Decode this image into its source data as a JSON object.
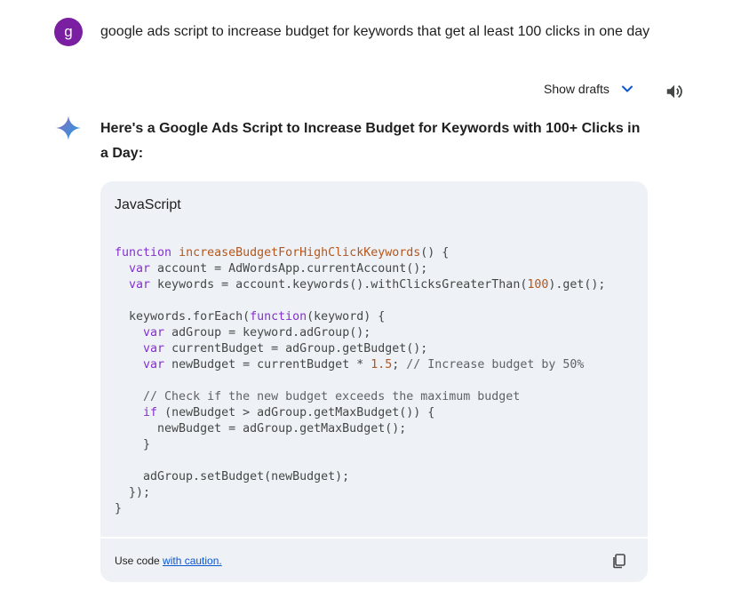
{
  "user": {
    "avatar_letter": "g",
    "avatar_color": "#7b1fa2",
    "prompt": "google ads script to increase budget for keywords that get al least 100 clicks in one day"
  },
  "toolbar": {
    "show_drafts_label": "Show drafts",
    "chevron_icon": "chevron-down-icon",
    "speaker_icon": "speaker-icon"
  },
  "response": {
    "sparkle_icon": "gemini-sparkle-icon",
    "heading": "Here's a Google Ads Script to Increase Budget for Keywords with 100+ Clicks in a Day:"
  },
  "code_block": {
    "language": "JavaScript",
    "lines": [
      [
        [
          "kw",
          "function "
        ],
        [
          "fn",
          "increaseBudgetForHighClickKeywords"
        ],
        [
          "plain",
          "() {"
        ]
      ],
      [
        [
          "plain",
          "  "
        ],
        [
          "kw",
          "var "
        ],
        [
          "plain",
          "account = AdWordsApp.currentAccount();"
        ]
      ],
      [
        [
          "plain",
          "  "
        ],
        [
          "kw",
          "var "
        ],
        [
          "plain",
          "keywords = account.keywords().withClicksGreaterThan("
        ],
        [
          "num",
          "100"
        ],
        [
          "plain",
          ").get();"
        ]
      ],
      [],
      [
        [
          "plain",
          "  keywords.forEach("
        ],
        [
          "kw",
          "function"
        ],
        [
          "plain",
          "(keyword) {"
        ]
      ],
      [
        [
          "plain",
          "    "
        ],
        [
          "kw",
          "var "
        ],
        [
          "plain",
          "adGroup = keyword.adGroup();"
        ]
      ],
      [
        [
          "plain",
          "    "
        ],
        [
          "kw",
          "var "
        ],
        [
          "plain",
          "currentBudget = adGroup.getBudget();"
        ]
      ],
      [
        [
          "plain",
          "    "
        ],
        [
          "kw",
          "var "
        ],
        [
          "plain",
          "newBudget = currentBudget * "
        ],
        [
          "num",
          "1.5"
        ],
        [
          "plain",
          "; "
        ],
        [
          "com",
          "// Increase budget by 50%"
        ]
      ],
      [],
      [
        [
          "plain",
          "    "
        ],
        [
          "com",
          "// Check if the new budget exceeds the maximum budget"
        ]
      ],
      [
        [
          "plain",
          "    "
        ],
        [
          "kw",
          "if "
        ],
        [
          "plain",
          "(newBudget > adGroup.getMaxBudget()) {"
        ]
      ],
      [
        [
          "plain",
          "      newBudget = adGroup.getMaxBudget();"
        ]
      ],
      [
        [
          "plain",
          "    }"
        ]
      ],
      [],
      [
        [
          "plain",
          "    adGroup.setBudget(newBudget);"
        ]
      ],
      [
        [
          "plain",
          "  });"
        ]
      ],
      [
        [
          "plain",
          "}"
        ]
      ]
    ],
    "footer_prefix": "Use code ",
    "footer_link": "with caution.",
    "copy_icon": "copy-icon"
  },
  "colors": {
    "keyword": "#8430ce",
    "function_name": "#b5561a",
    "number": "#b5561a",
    "comment": "#5f6368",
    "link": "#0b57d0",
    "code_background": "#eef1f6"
  }
}
